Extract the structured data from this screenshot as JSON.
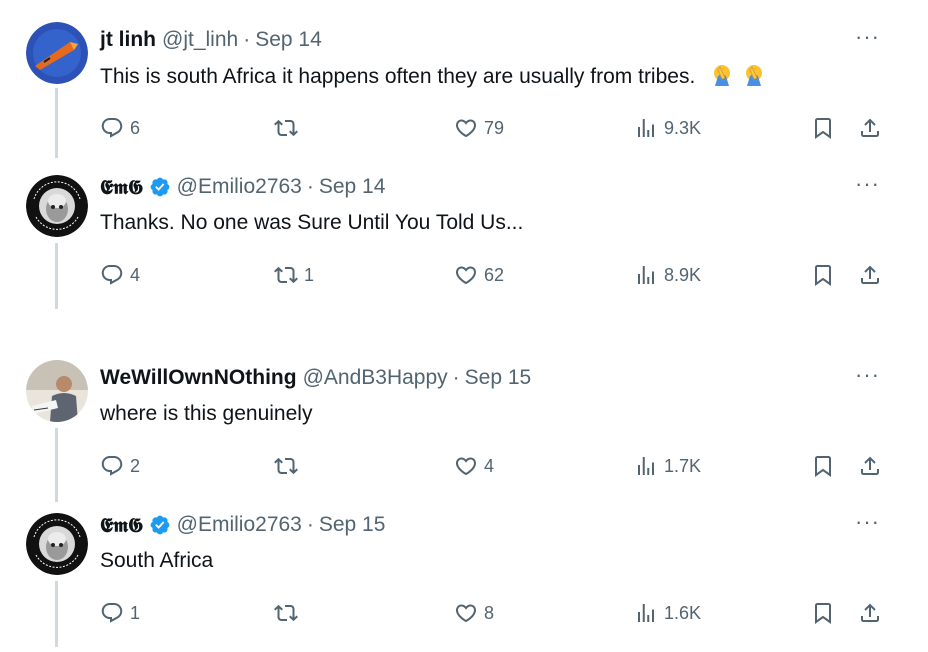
{
  "tweets": [
    {
      "name": "jt linh",
      "handle": "@jt_linh",
      "date": "Sep 14",
      "text": "This is south Africa it happens often they are usually from tribes.",
      "replies": "6",
      "retweets": "",
      "likes": "79",
      "views": "9.3K",
      "verified": false,
      "emoji": [
        "facepalm-emoji",
        "facepalm-emoji"
      ]
    },
    {
      "name": "𝕰𝖒𝕲",
      "handle": "@Emilio2763",
      "date": "Sep 14",
      "text": "Thanks. No one was Sure Until You Told Us...",
      "replies": "4",
      "retweets": "1",
      "likes": "62",
      "views": "8.9K",
      "verified": true
    },
    {
      "name": "WeWillOwnNOthing",
      "handle": "@AndB3Happy",
      "date": "Sep 15",
      "text": "where is this genuinely",
      "replies": "2",
      "retweets": "",
      "likes": "4",
      "views": "1.7K",
      "verified": false
    },
    {
      "name": "𝕰𝖒𝕲",
      "handle": "@Emilio2763",
      "date": "Sep 15",
      "text": "South Africa",
      "replies": "1",
      "retweets": "",
      "likes": "8",
      "views": "1.6K",
      "verified": true
    }
  ],
  "separator": "·",
  "more_label": "···",
  "colors": {
    "text": "#0f1419",
    "muted": "#536471",
    "verified": "#1d9bf0",
    "thread": "#cfd9de"
  }
}
